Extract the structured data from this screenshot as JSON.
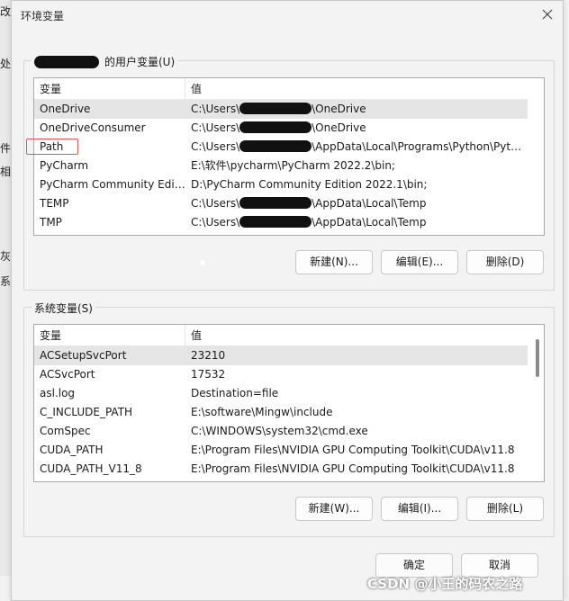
{
  "background_fragments": {
    "left": [
      "改进",
      "处",
      "件",
      "相",
      "灰",
      "系"
    ]
  },
  "dialog": {
    "title": "环境变量",
    "user_group_label": "的用户变量(U)",
    "system_group_label": "系统变量(S)",
    "col_var": "变量",
    "col_val": "值",
    "user_vars": [
      {
        "name": "OneDrive",
        "value_pre": "C:\\Users\\",
        "value_post": "\\OneDrive",
        "masked": true
      },
      {
        "name": "OneDriveConsumer",
        "value_pre": "C:\\Users\\",
        "value_post": "\\OneDrive",
        "masked": true
      },
      {
        "name": "Path",
        "value_pre": "C:\\Users\\",
        "value_post": "\\AppData\\Local\\Programs\\Python\\Pyth...",
        "masked": true
      },
      {
        "name": "PyCharm",
        "value_pre": "E:\\软件\\pycharm\\PyCharm 2022.2\\bin;",
        "value_post": "",
        "masked": false
      },
      {
        "name": "PyCharm Community Editi...",
        "value_pre": "D:\\PyCharm Community Edition 2022.1\\bin;",
        "value_post": "",
        "masked": false
      },
      {
        "name": "TEMP",
        "value_pre": "C:\\Users\\",
        "value_post": "\\AppData\\Local\\Temp",
        "masked": true
      },
      {
        "name": "TMP",
        "value_pre": "C:\\Users\\",
        "value_post": "\\AppData\\Local\\Temp",
        "masked": true
      }
    ],
    "system_vars": [
      {
        "name": "ACSetupSvcPort",
        "value": "23210"
      },
      {
        "name": "ACSvcPort",
        "value": "17532"
      },
      {
        "name": "asl.log",
        "value": "Destination=file"
      },
      {
        "name": "C_INCLUDE_PATH",
        "value": "E:\\software\\Mingw\\include"
      },
      {
        "name": "ComSpec",
        "value": "C:\\WINDOWS\\system32\\cmd.exe"
      },
      {
        "name": "CUDA_PATH",
        "value": "E:\\Program Files\\NVIDIA GPU Computing Toolkit\\CUDA\\v11.8"
      },
      {
        "name": "CUDA_PATH_V11_8",
        "value": "E:\\Program Files\\NVIDIA GPU Computing Toolkit\\CUDA\\v11.8"
      }
    ],
    "user_buttons": {
      "new": "新建(N)...",
      "edit": "编辑(E)...",
      "delete": "删除(D)"
    },
    "system_buttons": {
      "new": "新建(W)...",
      "edit": "编辑(I)...",
      "delete": "删除(L)"
    },
    "ok": "确定",
    "cancel": "取消"
  },
  "watermark": "CSDN @小王的码农之路",
  "colors": {
    "annotation": "#e35656",
    "selected_row": "#e5e5e5"
  }
}
